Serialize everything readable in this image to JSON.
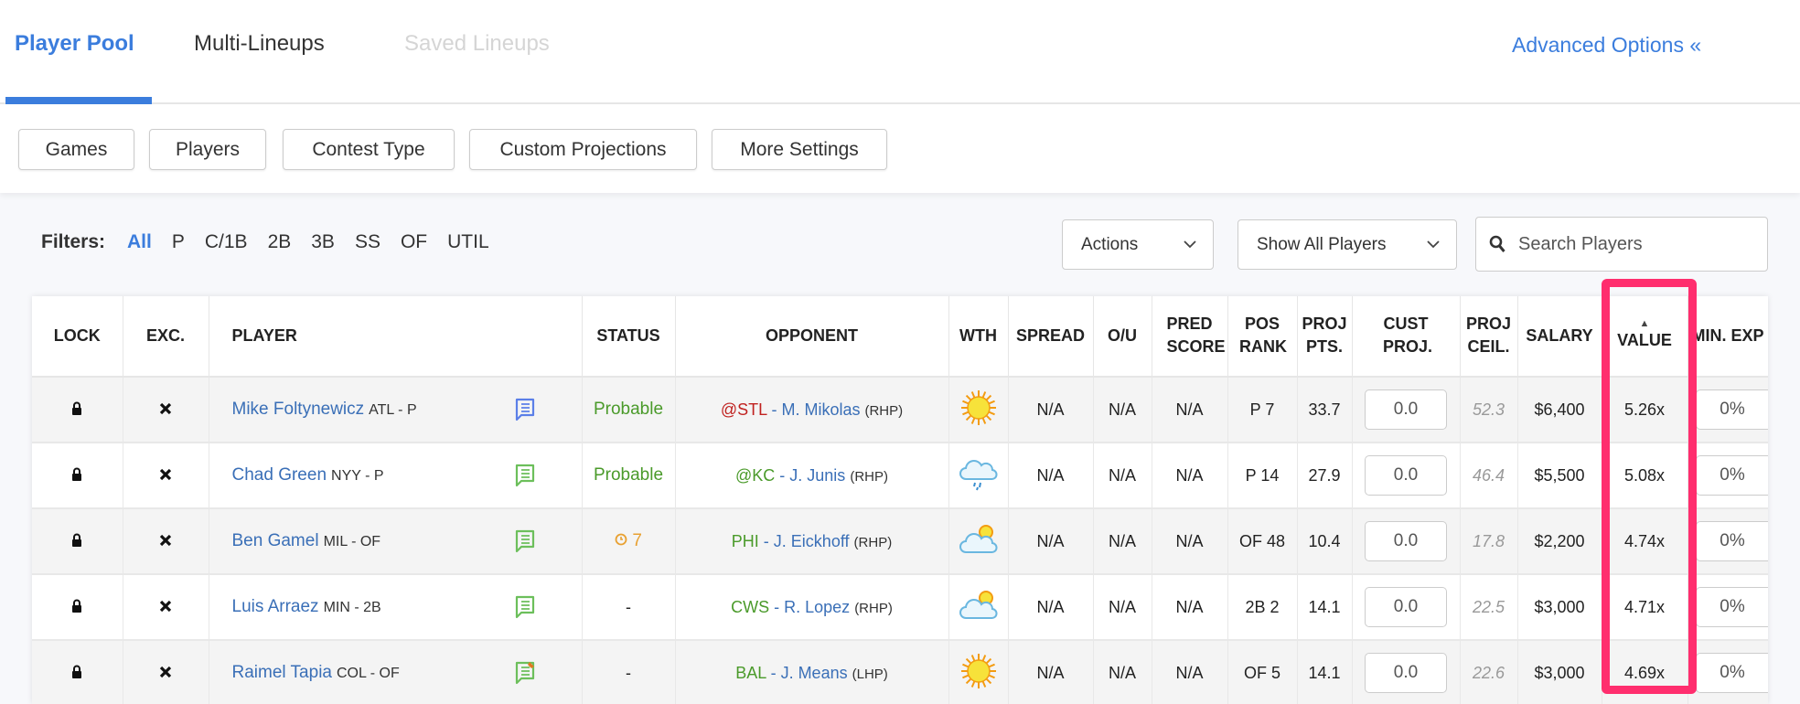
{
  "tabs": [
    {
      "label": "Player Pool",
      "state": "active"
    },
    {
      "label": "Multi-Lineups",
      "state": "normal"
    },
    {
      "label": "Saved Lineups",
      "state": "disabled"
    }
  ],
  "advanced_options": "Advanced Options «",
  "buttons": [
    "Games",
    "Players",
    "Contest Type",
    "Custom Projections",
    "More Settings"
  ],
  "filters": {
    "label": "Filters:",
    "items": [
      "All",
      "P",
      "C/1B",
      "2B",
      "3B",
      "SS",
      "OF",
      "UTIL"
    ],
    "active": "All"
  },
  "actions_dropdown": "Actions",
  "show_dropdown": "Show All Players",
  "search": {
    "placeholder": "Search Players",
    "value": ""
  },
  "colors": {
    "accent": "#3b7ddd",
    "highlight": "#ff2e6e",
    "probable": "#4a9a2a",
    "away_red": "#c0211f",
    "opp_green": "#4a9a2a"
  },
  "table": {
    "headers": [
      "LOCK",
      "EXC.",
      "PLAYER",
      "STATUS",
      "OPPONENT",
      "WTH",
      "SPREAD",
      "O/U",
      "PRED SCORE",
      "POS RANK",
      "PROJ PTS.",
      "CUST PROJ.",
      "PROJ CEIL.",
      "SALARY",
      "VALUE",
      "MIN. EXP"
    ],
    "sorted_column": "VALUE",
    "sort_direction": "ascending-arrow",
    "rows": [
      {
        "name": "Mike Foltynewicz",
        "meta": "ATL - P",
        "note_icon": "comment-blue",
        "status": "Probable",
        "status_type": "probable",
        "opp_team": "@STL",
        "opp_color": "red",
        "opp_pitcher": "M. Mikolas",
        "opp_hand": "(RHP)",
        "weather": "sunny",
        "spread": "N/A",
        "ou": "N/A",
        "pred": "N/A",
        "pos_rank": "P 7",
        "proj": "33.7",
        "cust": "0.0",
        "ceil": "52.3",
        "salary": "$6,400",
        "value": "5.26x",
        "min_exp": "0%"
      },
      {
        "name": "Chad Green",
        "meta": "NYY - P",
        "note_icon": "comment-green",
        "status": "Probable",
        "status_type": "probable",
        "opp_team": "@KC",
        "opp_color": "green",
        "opp_pitcher": "J. Junis",
        "opp_hand": "(RHP)",
        "weather": "rain",
        "spread": "N/A",
        "ou": "N/A",
        "pred": "N/A",
        "pos_rank": "P 14",
        "proj": "27.9",
        "cust": "0.0",
        "ceil": "46.4",
        "salary": "$5,500",
        "value": "5.08x",
        "min_exp": "0%"
      },
      {
        "name": "Ben Gamel",
        "meta": "MIL - OF",
        "note_icon": "comment-green",
        "status": "7",
        "status_type": "clock",
        "opp_team": "PHI",
        "opp_color": "green",
        "opp_pitcher": "J. Eickhoff",
        "opp_hand": "(RHP)",
        "weather": "partly-cloudy",
        "spread": "N/A",
        "ou": "N/A",
        "pred": "N/A",
        "pos_rank": "OF 48",
        "proj": "10.4",
        "cust": "0.0",
        "ceil": "17.8",
        "salary": "$2,200",
        "value": "4.74x",
        "min_exp": "0%"
      },
      {
        "name": "Luis Arraez",
        "meta": "MIN - 2B",
        "note_icon": "comment-green",
        "status": "-",
        "status_type": "none",
        "opp_team": "CWS",
        "opp_color": "green",
        "opp_pitcher": "R. Lopez",
        "opp_hand": "(RHP)",
        "weather": "partly-cloudy",
        "spread": "N/A",
        "ou": "N/A",
        "pred": "N/A",
        "pos_rank": "2B 2",
        "proj": "14.1",
        "cust": "0.0",
        "ceil": "22.5",
        "salary": "$3,000",
        "value": "4.71x",
        "min_exp": "0%"
      },
      {
        "name": "Raimel Tapia",
        "meta": "COL - OF",
        "note_icon": "comment-green-edit",
        "status": "-",
        "status_type": "none",
        "opp_team": "BAL",
        "opp_color": "green",
        "opp_pitcher": "J. Means",
        "opp_hand": "(LHP)",
        "weather": "sunny",
        "spread": "N/A",
        "ou": "N/A",
        "pred": "N/A",
        "pos_rank": "OF 5",
        "proj": "14.1",
        "cust": "0.0",
        "ceil": "22.6",
        "salary": "$3,000",
        "value": "4.69x",
        "min_exp": "0%"
      }
    ]
  }
}
